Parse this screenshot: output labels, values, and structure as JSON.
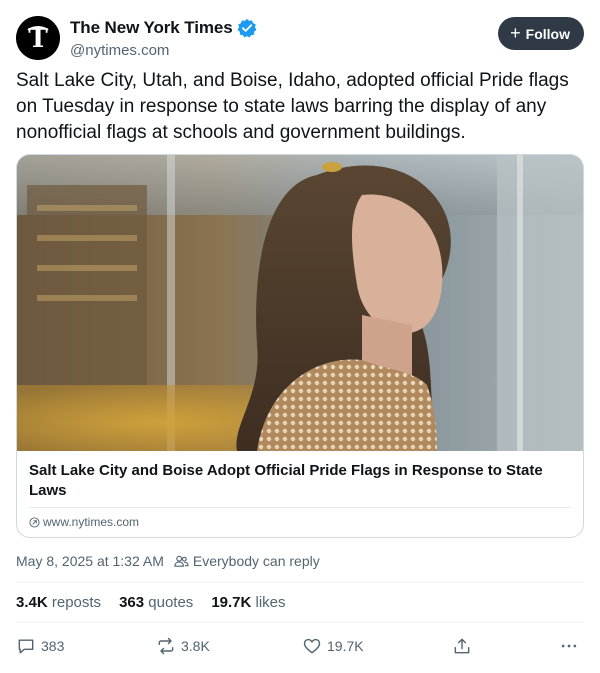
{
  "account": {
    "display_name": "The New York Times",
    "handle": "@nytimes.com",
    "avatar_icon": "nyt-logo-icon",
    "verified_icon": "verified-badge-icon",
    "verified_color": "#1d9bf0"
  },
  "follow_button": {
    "label": "Follow",
    "icon": "plus-icon"
  },
  "tweet": {
    "text": "Salt Lake City, Utah, and Boise, Idaho, adopted official Pride flags on Tuesday in response to state laws barring the display of any nonofficial flags at schools and government buildings."
  },
  "card": {
    "title": "Salt Lake City and Boise Adopt Official Pride Flags in Response to State Laws",
    "domain": "www.nytimes.com",
    "link_icon": "link-icon"
  },
  "meta": {
    "timestamp": "May 8, 2025 at 1:32 AM",
    "reply_setting": "Everybody can reply",
    "reply_icon": "people-icon"
  },
  "stats": {
    "reposts_count": "3.4K",
    "reposts_label": "reposts",
    "quotes_count": "363",
    "quotes_label": "quotes",
    "likes_count": "19.7K",
    "likes_label": "likes"
  },
  "actions": {
    "replies": "383",
    "reposts": "3.8K",
    "likes": "19.7K"
  },
  "colors": {
    "text_primary": "#0f1419",
    "text_secondary": "#536471",
    "follow_bg": "#2f3a46",
    "border": "#cfd9de"
  }
}
